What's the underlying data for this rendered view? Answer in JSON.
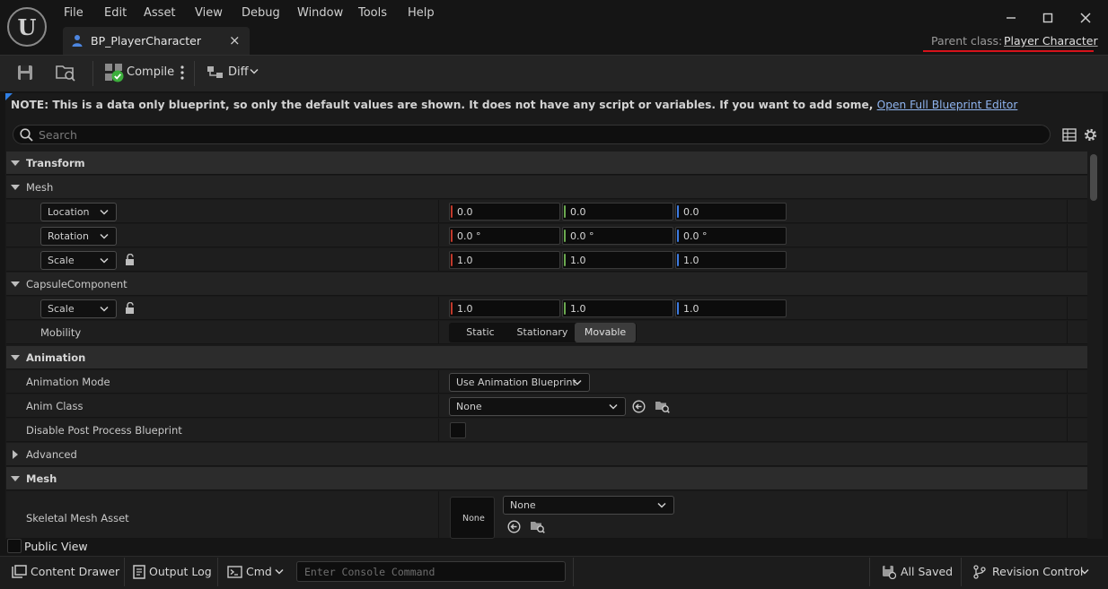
{
  "menu": [
    "File",
    "Edit",
    "Asset",
    "View",
    "Debug",
    "Window",
    "Tools",
    "Help"
  ],
  "tab": {
    "label": "BP_PlayerCharacter",
    "close": "×"
  },
  "parent_class": {
    "label": "Parent class:",
    "value": "Player Character"
  },
  "toolbar": {
    "compile_label": "Compile",
    "diff_label": "Diff"
  },
  "note": {
    "text": "NOTE: This is a data only blueprint, so only the default values are shown.  It does not have any script or variables.  If you want to add some, ",
    "link": "Open Full Blueprint Editor"
  },
  "search": {
    "placeholder": "Search"
  },
  "sections": {
    "transform": "Transform",
    "mesh_sub": "Mesh",
    "capsule_sub": "CapsuleComponent",
    "animation": "Animation",
    "advanced": "Advanced",
    "mesh": "Mesh"
  },
  "props": {
    "location": {
      "mode": "Location",
      "x": "0.0",
      "y": "0.0",
      "z": "0.0"
    },
    "rotation": {
      "mode": "Rotation",
      "x": "0.0 °",
      "y": "0.0 °",
      "z": "0.0 °"
    },
    "scale": {
      "mode": "Scale",
      "x": "1.0",
      "y": "1.0",
      "z": "1.0"
    },
    "capsule_scale": {
      "mode": "Scale",
      "x": "1.0",
      "y": "1.0",
      "z": "1.0"
    },
    "mobility": {
      "label": "Mobility",
      "options": [
        "Static",
        "Stationary",
        "Movable"
      ],
      "selected": "Movable"
    },
    "animation_mode": {
      "label": "Animation Mode",
      "value": "Use Animation Blueprint"
    },
    "anim_class": {
      "label": "Anim Class",
      "value": "None"
    },
    "disable_post_process": {
      "label": "Disable Post Process Blueprint",
      "checked": false
    },
    "skeletal_mesh": {
      "label": "Skeletal Mesh Asset",
      "thumb": "None",
      "value": "None"
    }
  },
  "public_view": {
    "label": "Public View",
    "checked": false
  },
  "statusbar": {
    "content_drawer": "Content Drawer",
    "output_log": "Output Log",
    "cmd": "Cmd",
    "console_placeholder": "Enter Console Command",
    "all_saved": "All Saved",
    "revision_control": "Revision Control"
  },
  "colors": {
    "x_axis": "#c0392b",
    "y_axis": "#6aa84f",
    "z_axis": "#3d7be0",
    "accent_red": "#d6121a",
    "link": "#8fb4ef"
  }
}
